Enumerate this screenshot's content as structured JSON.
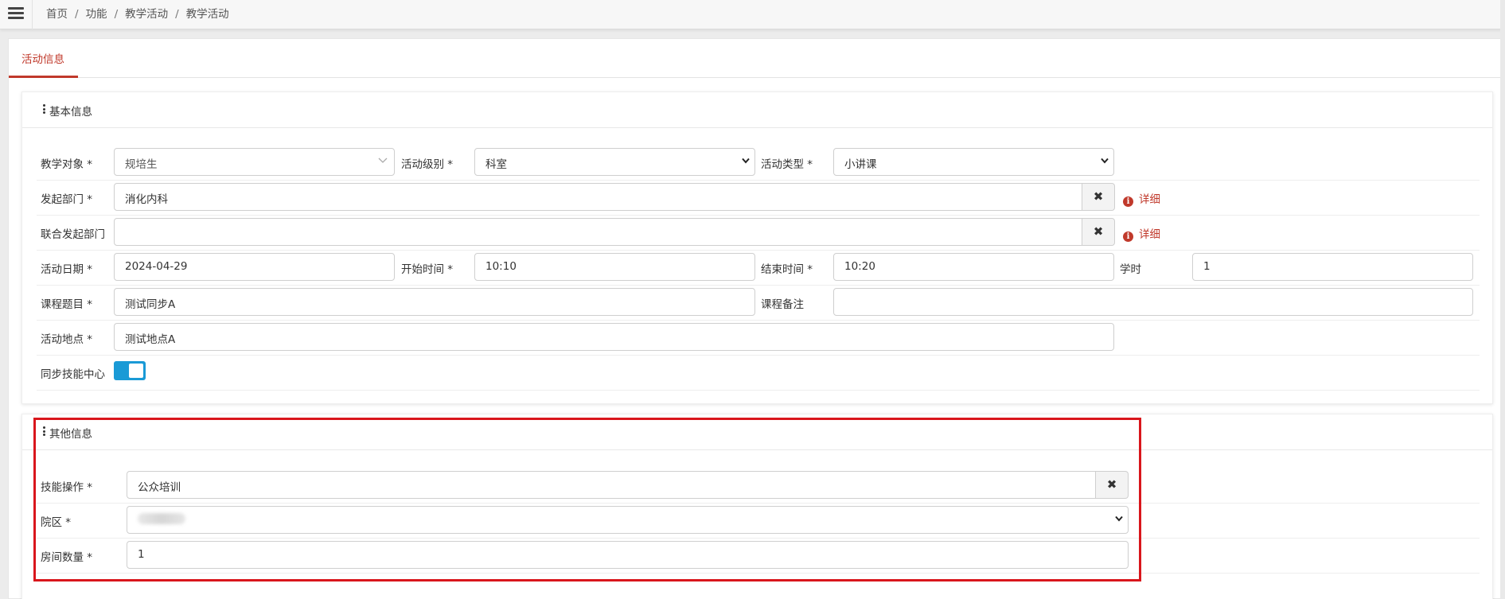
{
  "breadcrumb": {
    "items": [
      "首页",
      "功能",
      "教学活动",
      "教学活动"
    ],
    "separator": "/"
  },
  "tabs": {
    "active_label": "活动信息"
  },
  "basic_section": {
    "title": "基本信息",
    "teaching_object": {
      "label": "教学对象 *",
      "value": "规培生"
    },
    "activity_level": {
      "label": "活动级别 *",
      "value": "科室"
    },
    "activity_type": {
      "label": "活动类型 *",
      "value": "小讲课"
    },
    "initiating_dept": {
      "label": "发起部门 *",
      "value": "消化内科",
      "clear": "✖",
      "detail": "详细"
    },
    "joint_dept": {
      "label": "联合发起部门",
      "value": "",
      "clear": "✖",
      "detail": "详细"
    },
    "activity_date": {
      "label": "活动日期 *",
      "value": "2024-04-29"
    },
    "start_time": {
      "label": "开始时间 *",
      "value": "10:10"
    },
    "end_time": {
      "label": "结束时间 *",
      "value": "10:20"
    },
    "hours": {
      "label": "学时",
      "value": "1"
    },
    "course_title": {
      "label": "课程题目 *",
      "value": "测试同步A"
    },
    "course_notes": {
      "label": "课程备注",
      "value": ""
    },
    "location": {
      "label": "活动地点 *",
      "value": "测试地点A"
    },
    "sync_skill_center": {
      "label": "同步技能中心",
      "enabled": true
    }
  },
  "other_section": {
    "title": "其他信息",
    "skill_operation": {
      "label": "技能操作 *",
      "value": "公众培训",
      "clear": "✖"
    },
    "campus": {
      "label": "院区 *"
    },
    "room_count": {
      "label": "房间数量 *",
      "value": "1"
    }
  },
  "colors": {
    "accent_red": "#c0392b",
    "toggle_blue": "#1a9ad6",
    "highlight_border": "#d9161c"
  }
}
